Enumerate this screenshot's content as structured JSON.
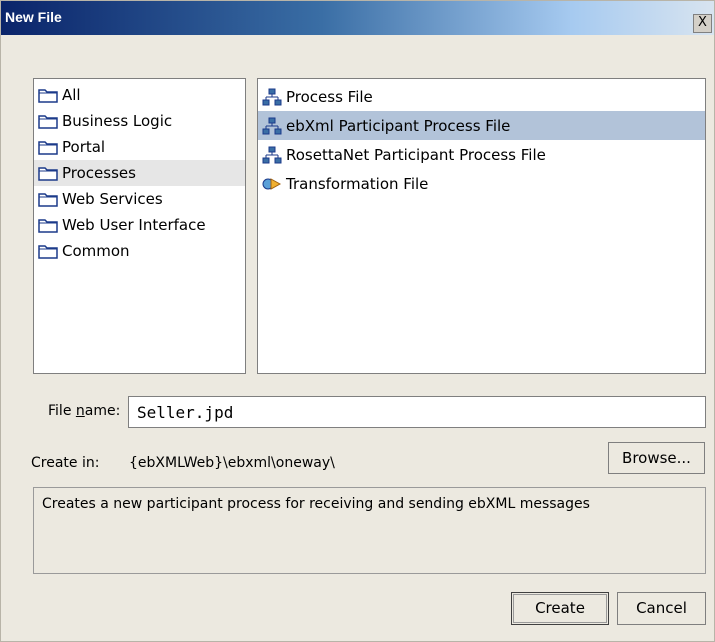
{
  "window": {
    "title": "New File",
    "close_label": "X"
  },
  "categories": [
    {
      "label": "All",
      "icon": "folder-icon"
    },
    {
      "label": "Business Logic",
      "icon": "folder-icon"
    },
    {
      "label": "Portal",
      "icon": "folder-icon"
    },
    {
      "label": "Processes",
      "icon": "folder-icon",
      "selected": true
    },
    {
      "label": "Web Services",
      "icon": "folder-icon"
    },
    {
      "label": "Web User Interface",
      "icon": "folder-icon"
    },
    {
      "label": "Common",
      "icon": "folder-icon"
    }
  ],
  "file_types": [
    {
      "label": "Process File",
      "icon": "process-icon"
    },
    {
      "label": "ebXml Participant Process File",
      "icon": "process-icon",
      "selected": true
    },
    {
      "label": "RosettaNet Participant Process File",
      "icon": "process-icon"
    },
    {
      "label": "Transformation File",
      "icon": "transformation-icon"
    }
  ],
  "form": {
    "file_name_label_pre": "File ",
    "file_name_label_underlined": "n",
    "file_name_label_post": "ame:",
    "file_name_value": "Seller.jpd",
    "create_in_label": "Create in:",
    "create_in_path": "{ebXMLWeb}\\ebxml\\oneway\\",
    "browse_label": "Browse..."
  },
  "description": "Creates a new participant process for receiving and sending ebXML messages",
  "buttons": {
    "create": "Create",
    "cancel": "Cancel"
  },
  "colors": {
    "selected_row": "#b2c3d9",
    "title_gradient_start": "#0a246a"
  }
}
